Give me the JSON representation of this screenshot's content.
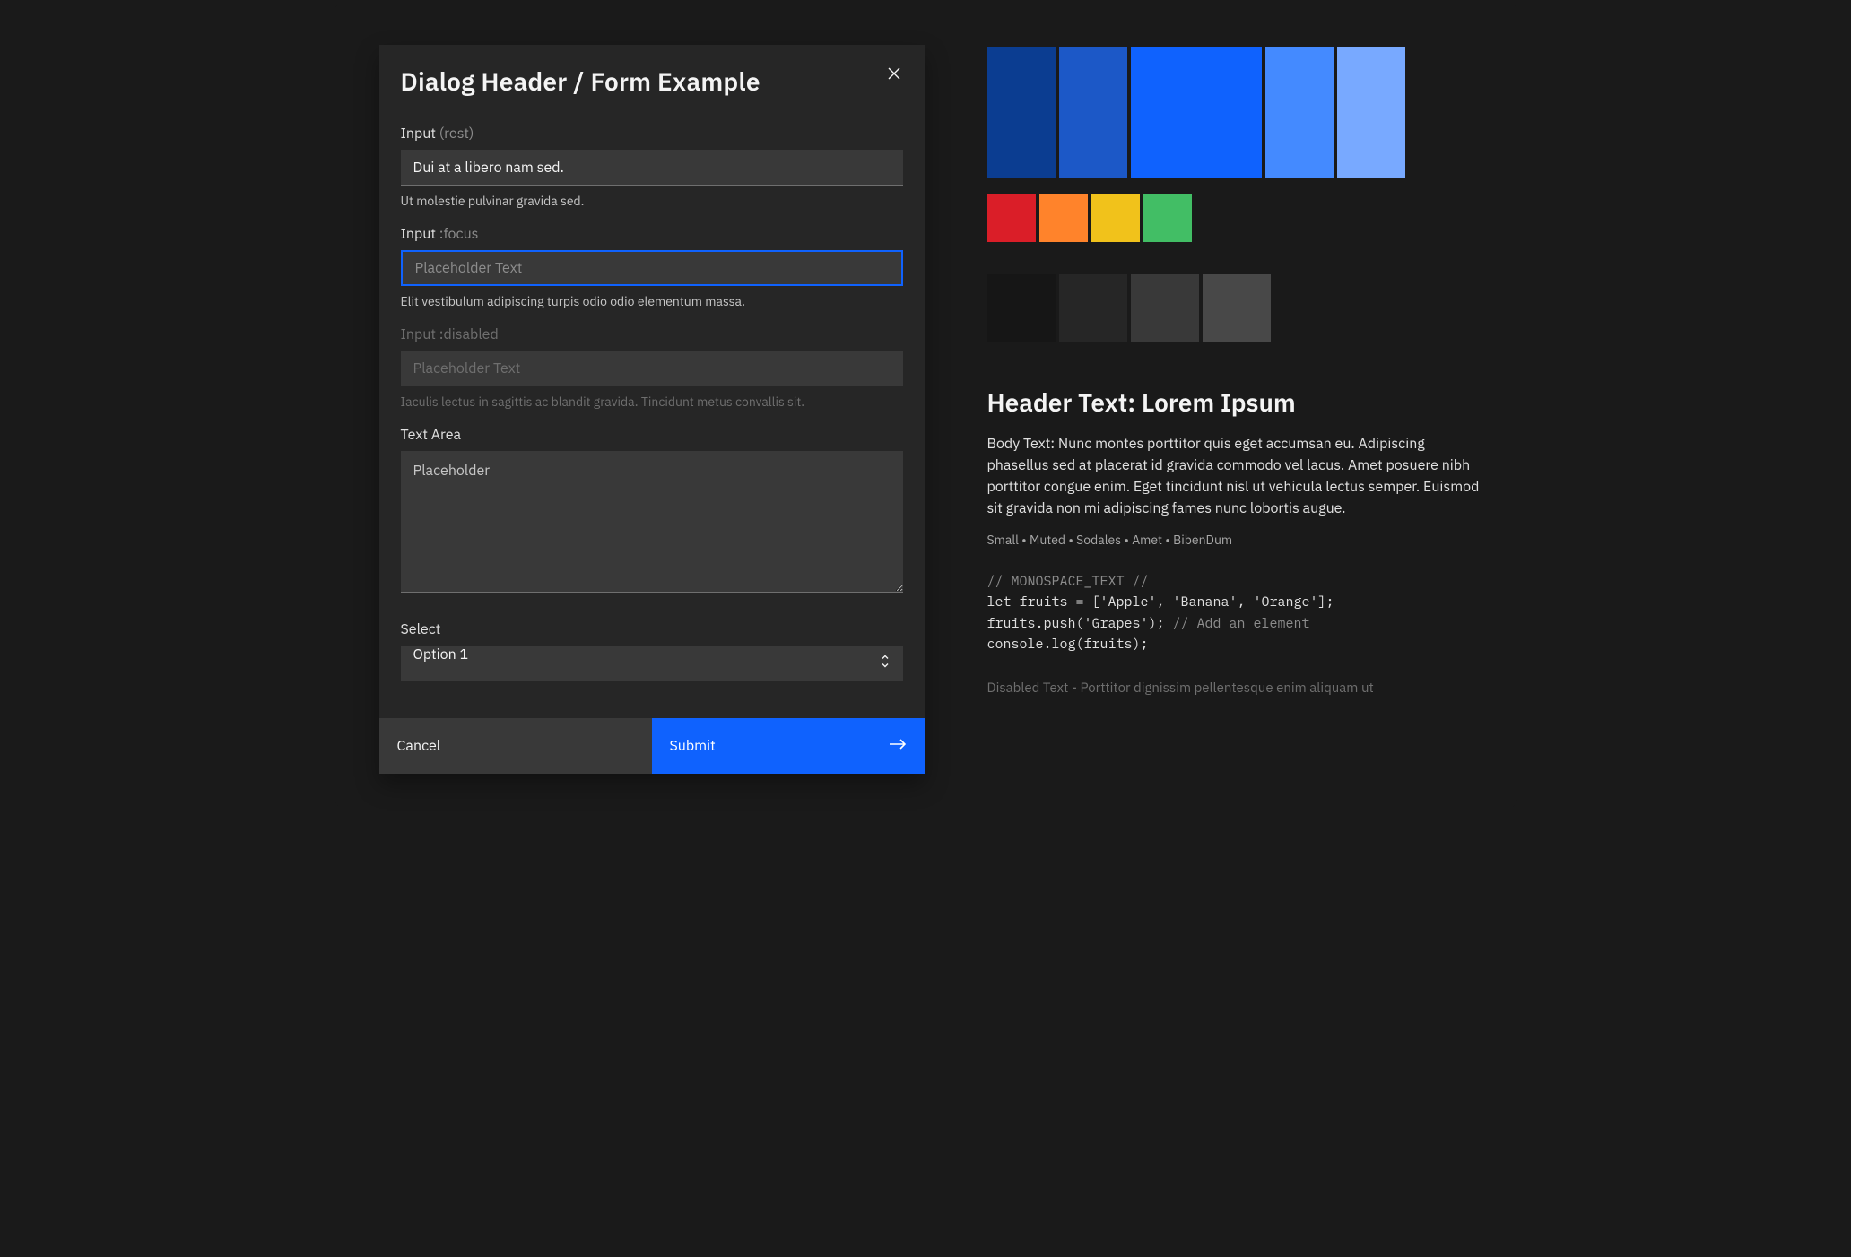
{
  "dialog": {
    "title": "Dialog Header / Form Example",
    "input_rest": {
      "label": "Input",
      "state": "(rest)",
      "value": "Dui at a libero nam sed.",
      "help": "Ut molestie pulvinar gravida sed."
    },
    "input_focus": {
      "label": "Input",
      "state": ":focus",
      "placeholder": "Placeholder Text",
      "help": "Elit vestibulum adipiscing turpis odio odio elementum massa."
    },
    "input_disabled": {
      "label": "Input",
      "state": ":disabled",
      "placeholder": "Placeholder Text",
      "help": "Iaculis lectus in sagittis ac blandit gravida. Tincidunt metus convallis sit."
    },
    "textarea": {
      "label": "Text Area",
      "placeholder": "Placeholder"
    },
    "select": {
      "label": "Select",
      "value": "Option 1"
    },
    "cancel_label": "Cancel",
    "submit_label": "Submit"
  },
  "palette": {
    "blues": [
      "#0b3d91",
      "#1c58c7",
      "#0f62fe",
      "#448aff",
      "#78a9ff"
    ],
    "status": [
      "#da1e28",
      "#ff832b",
      "#f1c21b",
      "#42be65"
    ],
    "grays": [
      "#161616",
      "#262626",
      "#393939",
      "#484848"
    ]
  },
  "sample": {
    "header": "Header Text: Lorem Ipsum",
    "body": "Body Text: Nunc montes porttitor quis eget accumsan eu. Adipiscing phasellus sed at placerat id gravida commodo vel lacus. Amet posuere nibh porttitor congue enim. Eget tincidunt nisl ut vehicula lectus semper. Euismod sit gravida non mi adipiscing fames nunc lobortis augue.",
    "small": "Small  •  Muted  •  Sodales  •  Amet  •  BibenDum",
    "code_comment1": "// MONOSPACE_TEXT //",
    "code_line1": "let fruits = ['Apple', 'Banana', 'Orange'];",
    "code_line2a": "fruits.push('Grapes'); ",
    "code_line2b": "// Add an element",
    "code_line3": "console.log(fruits);",
    "disabled": "Disabled Text - Porttitor dignissim pellentesque enim aliquam ut"
  }
}
